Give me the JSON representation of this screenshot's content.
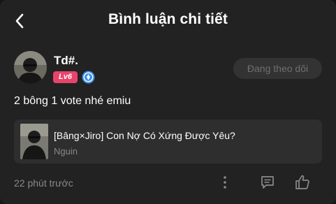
{
  "header": {
    "title": "Bình luận chi tiết",
    "back_icon": "chevron-left-icon"
  },
  "comment": {
    "username": "Td#.",
    "level": "Lv6",
    "follow_label": "Đang theo dõi",
    "text": "2 bông 1 vote nhé emiu",
    "timestamp": "22 phút trước"
  },
  "post": {
    "title": "[Bâng×Jiro] Con Nợ Có Xứng Được Yêu?",
    "author": "Nguin"
  },
  "icons": {
    "more": "more-vertical-icon",
    "reply": "comment-icon",
    "like": "thumbs-up-icon",
    "verify": "verified-badge-icon"
  },
  "colors": {
    "background": "#222222",
    "level_badge": "#e8446a",
    "verify_badge": "#3b8fe8",
    "follow_button_bg": "#333333",
    "muted_text": "#8a8a8a"
  }
}
